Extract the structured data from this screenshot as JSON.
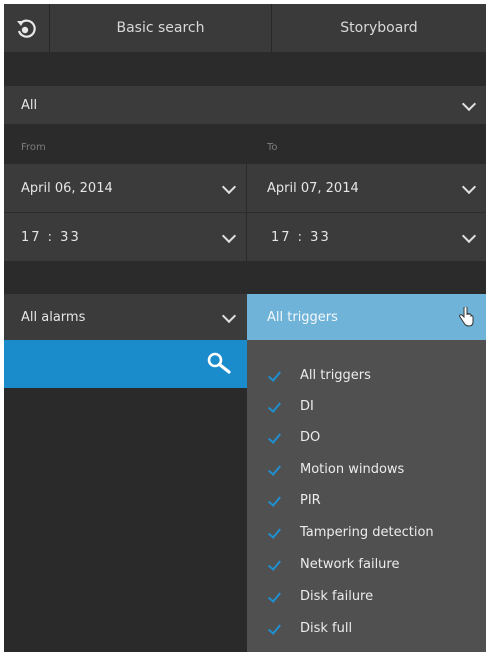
{
  "header": {
    "logo_icon": "rotate-camera-icon",
    "tabs": [
      {
        "label": "Basic search"
      },
      {
        "label": "Storyboard"
      }
    ]
  },
  "filter": {
    "scope_value": "All"
  },
  "range": {
    "from_label": "From",
    "to_label": "To",
    "from_date": "April 06, 2014",
    "to_date": "April 07, 2014",
    "from_time": "17 : 33",
    "to_time": "17 : 33"
  },
  "alarms": {
    "value": "All alarms"
  },
  "triggers": {
    "header_value": "All triggers",
    "items": [
      {
        "label": "All triggers",
        "checked": true
      },
      {
        "label": "DI",
        "checked": true
      },
      {
        "label": "DO",
        "checked": true
      },
      {
        "label": "Motion windows",
        "checked": true
      },
      {
        "label": "PIR",
        "checked": true
      },
      {
        "label": "Tampering detection",
        "checked": true
      },
      {
        "label": "Network failure",
        "checked": true
      },
      {
        "label": "Disk failure",
        "checked": true
      },
      {
        "label": "Disk full",
        "checked": true
      }
    ]
  },
  "colors": {
    "accent": "#1a8bcb",
    "dropdown_header": "#6fb4d8",
    "panel": "#3b3b3b",
    "background": "#2d2d2d"
  }
}
